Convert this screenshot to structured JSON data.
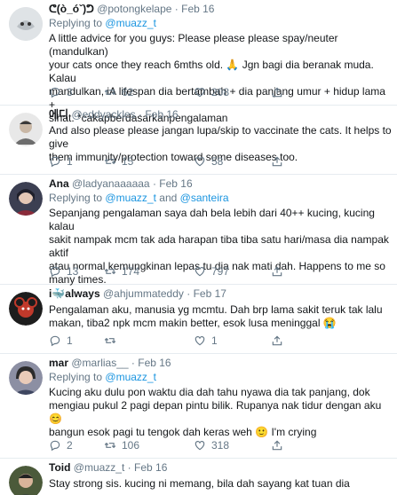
{
  "tweets": [
    {
      "name": "ᕦ(ò_óˇ)ᕤ",
      "handle": "@potongkelape",
      "date": "Feb 16",
      "replying_label": "Replying to",
      "mentions": [
        "@muazz_t"
      ],
      "mention_sep": "",
      "text_lines": [
        "A little advice for you guys: Please please please spay/neuter (mandulkan)",
        "your cats once they reach 6mths old. 🙏 Jgn bagi dia beranak muda. Kalau",
        "mandulkan, iA lifespan dia bertambah + dia panjang umur + hidup lama +",
        "sihat. *cakapberdasarkanpengalaman"
      ],
      "replies": "3",
      "retweets": "62",
      "likes": "208"
    },
    {
      "name": "에디",
      "handle": "@eddyackles",
      "date": "Feb 16",
      "replying_label": "",
      "mentions": [],
      "mention_sep": "",
      "text_lines": [
        "And also please please jangan lupa/skip to vaccinate the cats. It helps to give",
        "them immunity/protection toward some diseases too."
      ],
      "replies": "1",
      "retweets": "15",
      "likes": "58"
    },
    {
      "name": "Ana",
      "handle": "@ladyanaaaaaa",
      "date": "Feb 16",
      "replying_label": "Replying to",
      "mentions": [
        "@muazz_t",
        "@santeira"
      ],
      "mention_sep": "and",
      "text_lines": [
        "Sepanjang pengalaman saya dah bela lebih dari 40++ kucing, kucing kalau",
        "sakit nampak mcm tak ada harapan tiba tiba satu hari/masa dia nampak aktif",
        "atau normal kemungkinan lepas tu dia nak mati dah. Happens to me so",
        "many times."
      ],
      "replies": "13",
      "retweets": "174",
      "likes": "797"
    },
    {
      "name": "i🐳always",
      "handle": "@ahjummateddy",
      "date": "Feb 17",
      "replying_label": "",
      "mentions": [],
      "mention_sep": "",
      "text_lines": [
        "Pengalaman aku, manusia yg mcmtu. Dah brp lama sakit teruk  tak lalu",
        "makan, tiba2 npk mcm makin better, esok lusa meninggal 😭"
      ],
      "replies": "1",
      "retweets": "",
      "likes": "1"
    },
    {
      "name": "mar",
      "handle": "@marlias__",
      "date": "Feb 16",
      "replying_label": "Replying to",
      "mentions": [
        "@muazz_t"
      ],
      "mention_sep": "",
      "text_lines": [
        "Kucing aku dulu pon waktu dia dah tahu nyawa dia tak panjang, dok",
        "mengiau pukul 2 pagi depan pintu bilik. Rupanya nak tidur dengan aku 😊",
        "bangun esok pagi tu tengok dah keras weh 🙂 I'm crying"
      ],
      "replies": "2",
      "retweets": "106",
      "likes": "318"
    },
    {
      "name": "Toid",
      "handle": "@muazz_t",
      "date": "Feb 16",
      "replying_label": "",
      "mentions": [],
      "mention_sep": "",
      "text_lines": [
        "Stay strong sis. kucing ni memang, bila dah sayang kat tuan dia"
      ],
      "replies": "",
      "retweets": "",
      "likes": ""
    }
  ],
  "colors": {
    "text": "#14171a",
    "secondary": "#657786",
    "link": "#1b95e0",
    "border": "#e6ecf0"
  },
  "icons": [
    "reply-icon",
    "retweet-icon",
    "like-icon",
    "share-icon"
  ]
}
